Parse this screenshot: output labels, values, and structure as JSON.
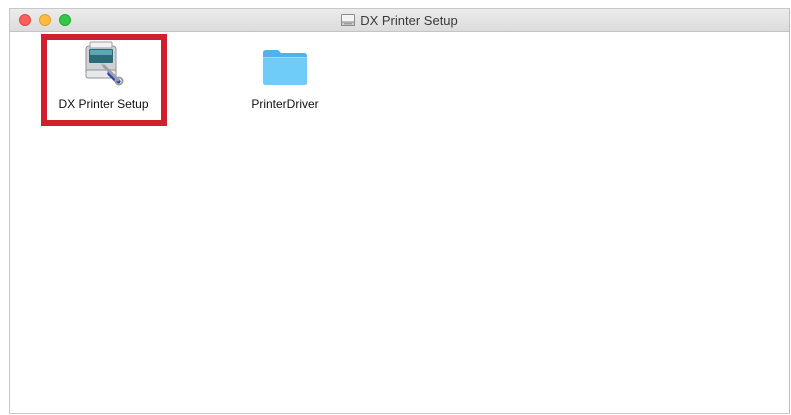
{
  "window": {
    "title": "DX Printer Setup",
    "title_icon": "disk-icon"
  },
  "files": [
    {
      "label": "DX Printer Setup",
      "icon": "printer-setup-app-icon",
      "highlighted": true
    },
    {
      "label": "PrinterDriver",
      "icon": "folder-icon",
      "highlighted": false
    }
  ],
  "colors": {
    "highlight": "#d0202e",
    "folder": "#5ec4f6"
  }
}
